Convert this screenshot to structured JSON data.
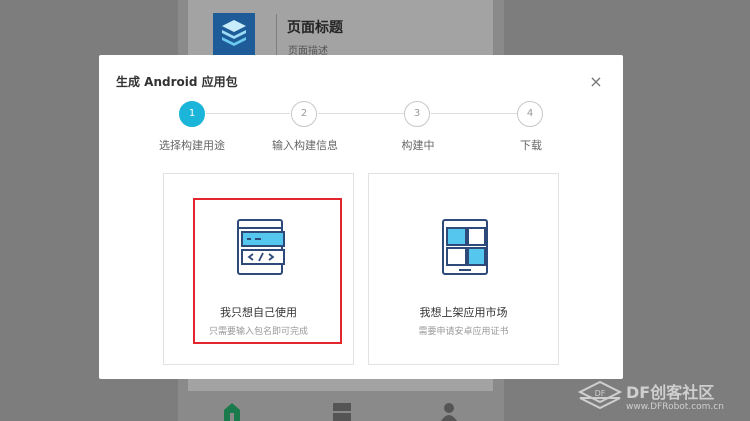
{
  "background": {
    "page_title": "页面标题",
    "page_desc": "页面描述",
    "nav_icons": [
      "home-icon",
      "grid-icon",
      "user-icon"
    ]
  },
  "dialog": {
    "title": "生成 Android 应用包",
    "close": "×",
    "steps": [
      {
        "number": "1",
        "label": "选择构建用途",
        "active": true
      },
      {
        "number": "2",
        "label": "输入构建信息",
        "active": false
      },
      {
        "number": "3",
        "label": "构建中",
        "active": false
      },
      {
        "number": "4",
        "label": "下载",
        "active": false
      }
    ],
    "options": [
      {
        "title": "我只想自己使用",
        "subtitle": "只需要输入包名即可完成",
        "icon": "code-window-icon",
        "highlighted": true
      },
      {
        "title": "我想上架应用市场",
        "subtitle": "需要申请安卓应用证书",
        "icon": "app-grid-icon",
        "highlighted": false
      }
    ]
  },
  "colors": {
    "accent": "#1ab5d8",
    "highlight": "#e3262b",
    "icon_stroke": "#2e4a7a",
    "icon_fill": "#55c6ee"
  },
  "watermark": {
    "brand": "DF创客社区",
    "url": "www.DFRobot.com.cn"
  }
}
